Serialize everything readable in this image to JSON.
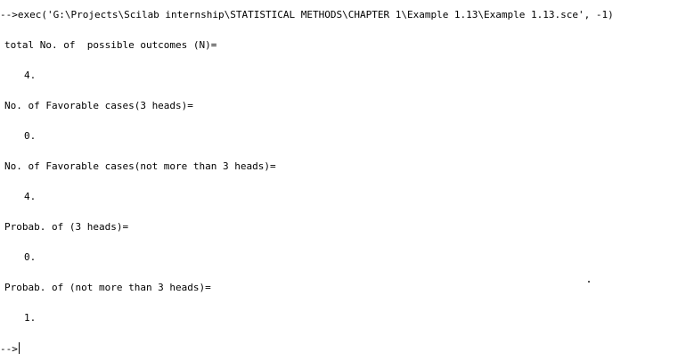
{
  "console": {
    "command_line": "-->exec('G:\\Projects\\Scilab internship\\STATISTICAL METHODS\\CHAPTER 1\\Example 1.13\\Example 1.13.sce', -1)",
    "outputs": [
      {
        "label": "total No. of  possible outcomes (N)=",
        "value": "4."
      },
      {
        "label": "No. of Favorable cases(3 heads)=",
        "value": "0."
      },
      {
        "label": "No. of Favorable cases(not more than 3 heads)=",
        "value": "4."
      },
      {
        "label": "Probab. of (3 heads)=",
        "value": "0."
      },
      {
        "label": "Probab. of (not more than 3 heads)=",
        "value": "1."
      }
    ],
    "prompt": "-->"
  }
}
